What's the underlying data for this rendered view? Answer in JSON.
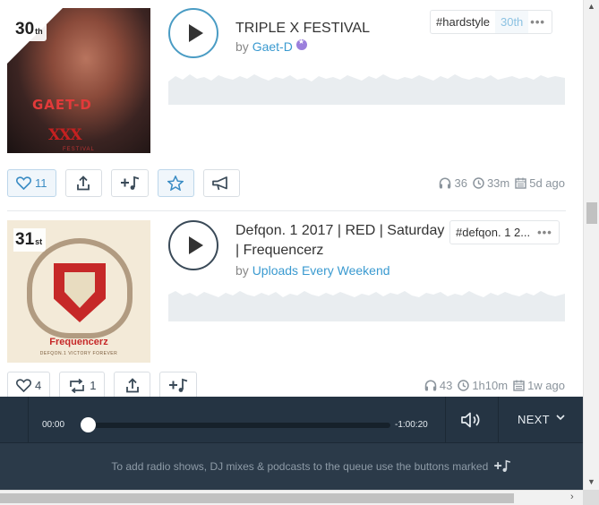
{
  "tracks": [
    {
      "rank": "30",
      "rank_suffix": "th",
      "title": "TRIPLE X FESTIVAL",
      "by_prefix": "by",
      "artist": "Gaet-D",
      "art_text": "GAET-D",
      "art_logo": "XXX",
      "art_sub": "FESTIVAL",
      "tag": "#hardstyle",
      "tag_position": "30th",
      "more": "•••",
      "likes": "11",
      "listens": "36",
      "duration": "33m",
      "age": "5d ago"
    },
    {
      "rank": "31",
      "rank_suffix": "st",
      "title": "Defqon. 1 2017 | RED | Saturday | Frequencerz",
      "by_prefix": "by",
      "artist": "Uploads Every Weekend",
      "art_text": "Frequencerz",
      "art_sub": "DEFQON.1 VICTORY FOREVER",
      "tag": "#defqon. 1 2...",
      "more": "•••",
      "likes": "4",
      "reposts": "1",
      "listens": "43",
      "duration": "1h10m",
      "age": "1w ago"
    }
  ],
  "player": {
    "elapsed": "00:00",
    "remaining": "-1:00:20",
    "progress": 0,
    "next_label": "NEXT",
    "hint": "To add radio shows, DJ mixes & podcasts to the queue use the buttons marked"
  },
  "colors": {
    "accent": "#3a9ad0",
    "player_bg": "#2b3a49",
    "waveform": "#e9edf0"
  },
  "icons": [
    "heart-icon",
    "share-icon",
    "add-to-queue-icon",
    "favorite-star-icon",
    "promote-megaphone-icon",
    "repost-icon",
    "headphones-icon",
    "clock-icon",
    "calendar-icon",
    "volume-icon",
    "chevron-down-icon"
  ]
}
